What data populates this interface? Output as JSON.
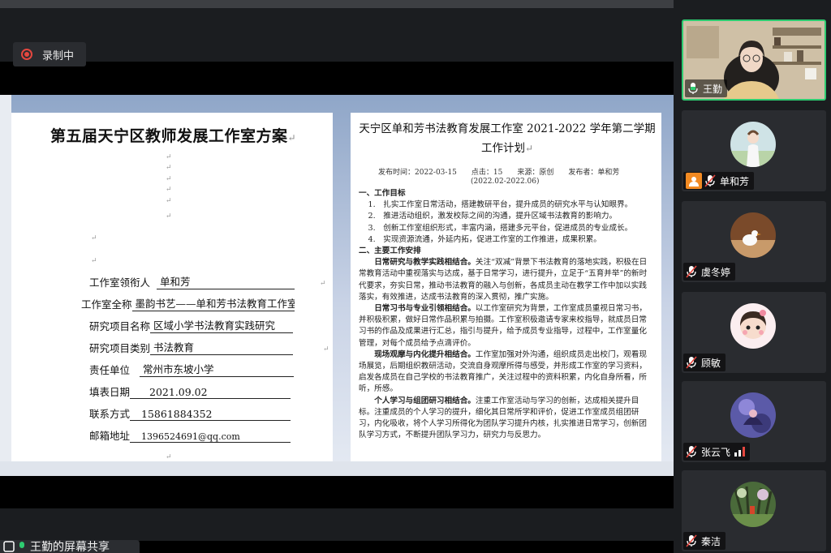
{
  "recording": {
    "label": "录制中"
  },
  "doc_left": {
    "title": "第五届天宁区教师发展工作室方案",
    "fields": [
      {
        "label": "工作室领衔人",
        "value": "单和芳"
      },
      {
        "label": "工作室全称",
        "value": "墨韵书艺——单和芳书法教育工作室"
      },
      {
        "label": "研究项目名称",
        "value": "区域小学书法教育实践研究"
      },
      {
        "label": "研究项目类别",
        "value": "书法教育"
      },
      {
        "label": "责任单位",
        "value": "常州市东坡小学"
      },
      {
        "label": "填表日期",
        "value": "2021.09.02"
      },
      {
        "label": "联系方式",
        "value": "15861884352"
      },
      {
        "label": "邮箱地址",
        "value": "1396524691@qq.com"
      }
    ]
  },
  "doc_right": {
    "title": "天宁区单和芳书法教育发展工作室 2021-2022 学年第二学期工作计划",
    "meta": "发布时间：2022-03-15　　点击：15　　来源：原创　　发布者：单和芳",
    "range": "(2022.02-2022.06)",
    "sec1_heading": "一、工作目标",
    "goals": [
      "1.　扎实工作室日常活动，搭建教研平台，提升成员的研究水平与认知眼界。",
      "2.　推进活动组织，激发校际之间的沟通，提升区域书法教育的影响力。",
      "3.　创新工作室组织形式，丰富内涵，搭建多元平台，促进成员的专业成长。",
      "4.　实现资源流通，外延内拓，促进工作室的工作推进，成果积累。"
    ],
    "sec2_heading": "二、主要工作安排",
    "paragraphs": [
      {
        "lead": "日常研究与教学实践相结合。",
        "text": "关注“双减”背景下书法教育的落地实践，积极在日常教育活动中重视落实与达成，基于日常学习，进行提升，立足于“五育并举”的新时代要求，夯实日常，推动书法教育的融入与创新，各成员主动在教学工作中加以实践落实，有效推进，达成书法教育的深入贯彻，推广实施。"
      },
      {
        "lead": "日常习书与专业引领相结合。",
        "text": "以工作室研究为背景，工作室成员重视日常习书，并积极积累，做好日常作品积累与拍摄。工作室积极邀请专家来校指导，就成员日常习书的作品及成果进行汇总，指引与提升，给予成员专业指导，过程中，工作室量化管理，对每个成员给予点滴评价。"
      },
      {
        "lead": "现场观摩与内化提升相结合。",
        "text": "工作室加强对外沟通，组织成员走出校门，观看现场展览，后期组织教研活动，交流自身观摩所得与感受，并形成工作室的学习资料，启发各成员在自己学校的书法教育推广，关注过程中的资料积累，内化自身所看，所听，所感。"
      },
      {
        "lead": "个人学习与组团研习相结合。",
        "text": "注重工作室活动与学习的创新，达成相关提升目标。注重成员的个人学习的提升，细化其日常所学和评价，促进工作室成员组团研习，内化吸收，将个人学习所得化为团队学习提升内核，扎实推进日常学习，创新团队学习方式，不断提升团队学习力，研究力与反思力。"
      }
    ]
  },
  "share_banner": {
    "label": "王勤的屏幕共享"
  },
  "participants": [
    {
      "name": "王勤",
      "video": true,
      "active": true,
      "muted": false
    },
    {
      "name": "单和芳",
      "video": false,
      "host": true,
      "muted": true
    },
    {
      "name": "虞冬婷",
      "video": false,
      "muted": true
    },
    {
      "name": "顾敏",
      "video": false,
      "muted": true
    },
    {
      "name": "张云飞",
      "video": false,
      "muted": true,
      "speaking": true
    },
    {
      "name": "秦洁",
      "video": false,
      "muted": true
    }
  ],
  "colors": {
    "active_border": "#2ecc71",
    "record_red": "#e5473f",
    "host_orange": "#f28a22"
  }
}
